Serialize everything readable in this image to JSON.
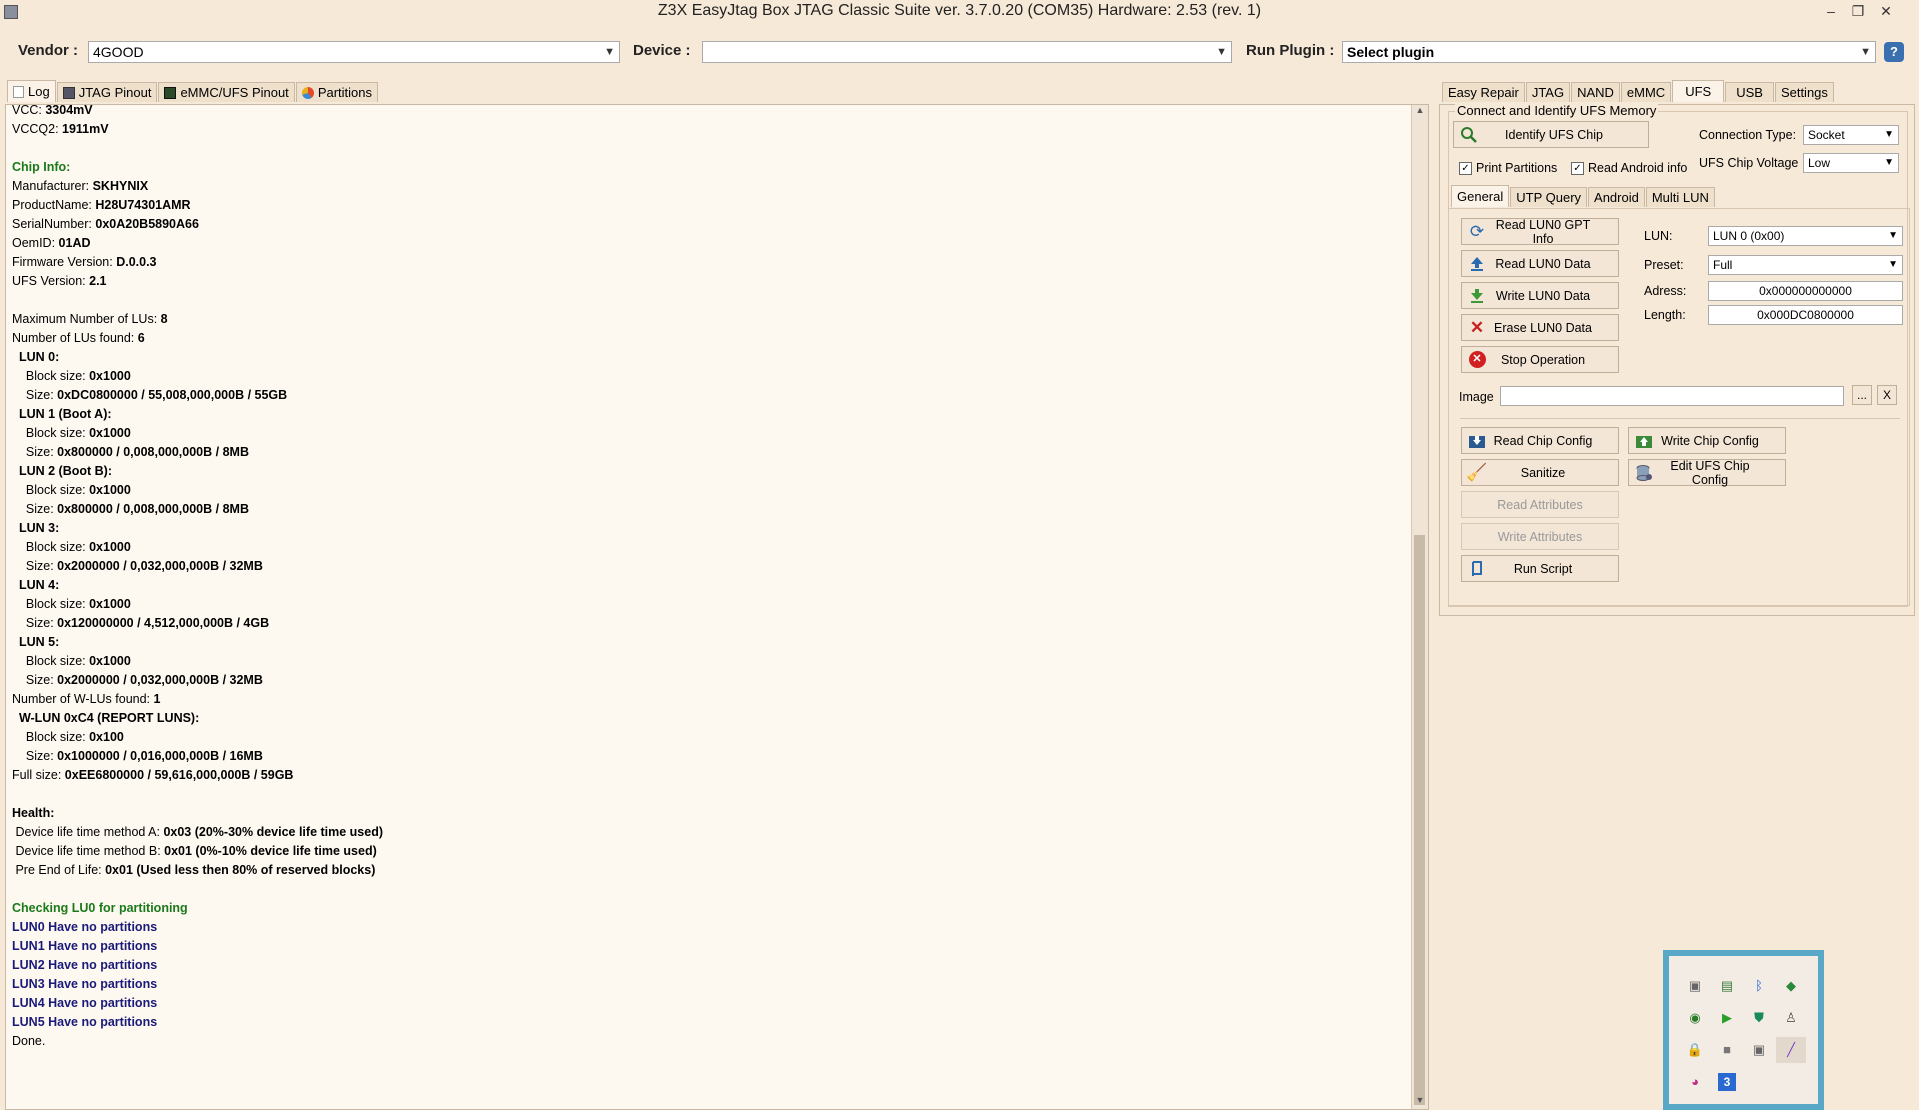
{
  "window": {
    "title": "Z3X EasyJtag Box JTAG Classic Suite ver. 3.7.0.20 (COM35) Hardware: 2.53 (rev. 1)"
  },
  "toolbar": {
    "vendor_label": "Vendor :",
    "vendor_value": "4GOOD",
    "device_label": "Device :",
    "device_value": "",
    "plugin_label": "Run Plugin :",
    "plugin_value": "Select plugin",
    "help": "?"
  },
  "left_tabs": [
    "Log",
    "JTAG Pinout",
    "eMMC/UFS Pinout",
    "Partitions"
  ],
  "right_tabs": [
    "Easy Repair",
    "JTAG",
    "NAND",
    "eMMC",
    "UFS",
    "USB",
    "Settings"
  ],
  "log": [
    {
      "k": "VCC: ",
      "v": "3304mV"
    },
    {
      "k": "VCCQ2: ",
      "v": "1911mV"
    },
    {
      "k": "",
      "v": ""
    },
    {
      "green": "Chip Info:"
    },
    {
      "k": "Manufacturer: ",
      "v": "SKHYNIX"
    },
    {
      "k": "ProductName: ",
      "v": "H28U74301AMR"
    },
    {
      "k": "SerialNumber: ",
      "v": "0x0A20B5890A66"
    },
    {
      "k": "OemID: ",
      "v": "01AD"
    },
    {
      "k": "Firmware Version: ",
      "v": "D.0.0.3"
    },
    {
      "k": "UFS Version: ",
      "v": "2.1"
    },
    {
      "k": "",
      "v": ""
    },
    {
      "k": "Maximum Number of LUs: ",
      "v": "8"
    },
    {
      "k": "Number of LUs found: ",
      "v": "6"
    },
    {
      "k": "  ",
      "v": "LUN 0:"
    },
    {
      "k": "    Block size: ",
      "v": "0x1000"
    },
    {
      "k": "    Size: ",
      "v": "0xDC0800000 / 55,008,000,000B / 55GB"
    },
    {
      "k": "  ",
      "v": "LUN 1 (Boot A):"
    },
    {
      "k": "    Block size: ",
      "v": "0x1000"
    },
    {
      "k": "    Size: ",
      "v": "0x800000 / 0,008,000,000B / 8MB"
    },
    {
      "k": "  ",
      "v": "LUN 2 (Boot B):"
    },
    {
      "k": "    Block size: ",
      "v": "0x1000"
    },
    {
      "k": "    Size: ",
      "v": "0x800000 / 0,008,000,000B / 8MB"
    },
    {
      "k": "  ",
      "v": "LUN 3:"
    },
    {
      "k": "    Block size: ",
      "v": "0x1000"
    },
    {
      "k": "    Size: ",
      "v": "0x2000000 / 0,032,000,000B / 32MB"
    },
    {
      "k": "  ",
      "v": "LUN 4:"
    },
    {
      "k": "    Block size: ",
      "v": "0x1000"
    },
    {
      "k": "    Size: ",
      "v": "0x120000000 / 4,512,000,000B / 4GB"
    },
    {
      "k": "  ",
      "v": "LUN 5:"
    },
    {
      "k": "    Block size: ",
      "v": "0x1000"
    },
    {
      "k": "    Size: ",
      "v": "0x2000000 / 0,032,000,000B / 32MB"
    },
    {
      "k": "Number of W-LUs found: ",
      "v": "1"
    },
    {
      "k": "  ",
      "v": "W-LUN 0xC4 (REPORT LUNS):"
    },
    {
      "k": "    Block size: ",
      "v": "0x100"
    },
    {
      "k": "    Size: ",
      "v": "0x1000000 / 0,016,000,000B / 16MB"
    },
    {
      "k": "Full size: ",
      "v": "0xEE6800000 / 59,616,000,000B / 59GB"
    },
    {
      "k": "",
      "v": ""
    },
    {
      "k": "",
      "v": "Health:"
    },
    {
      "k": " Device life time method A: ",
      "v": "0x03 (20%-30% device life time used)"
    },
    {
      "k": " Device life time method B: ",
      "v": "0x01 (0%-10% device life time used)"
    },
    {
      "k": " Pre End of Life: ",
      "v": "0x01 (Used less then 80% of reserved blocks)"
    },
    {
      "k": "",
      "v": ""
    },
    {
      "green": "Checking LU0 for partitioning"
    },
    {
      "navy": "LUN0 Have no partitions"
    },
    {
      "navy": "LUN1 Have no partitions"
    },
    {
      "navy": "LUN2 Have no partitions"
    },
    {
      "navy": "LUN3 Have no partitions"
    },
    {
      "navy": "LUN4 Have no partitions"
    },
    {
      "navy": "LUN5 Have no partitions"
    },
    {
      "k": "Done.",
      "v": ""
    }
  ],
  "ufs": {
    "group_title": "Connect and Identify UFS Memory",
    "identify_button": "Identify UFS Chip",
    "connection_type_label": "Connection Type:",
    "connection_type_value": "Socket",
    "print_partitions": "Print Partitions",
    "read_android_info": "Read Android info",
    "chip_voltage_label": "UFS Chip Voltage :",
    "chip_voltage_value": "Low",
    "subtabs": [
      "General",
      "UTP Query",
      "Android",
      "Multi LUN"
    ],
    "buttons": {
      "read_gpt": "Read LUN0 GPT Info",
      "read_data": "Read LUN0 Data",
      "write_data": "Write LUN0 Data",
      "erase_data": "Erase LUN0 Data",
      "stop": "Stop Operation",
      "read_config": "Read Chip Config",
      "write_config": "Write Chip Config",
      "sanitize": "Sanitize",
      "edit_config": "Edit UFS Chip Config",
      "read_attrs": "Read Attributes",
      "write_attrs": "Write Attributes",
      "run_script": "Run Script",
      "browse": "...",
      "clear": "X"
    },
    "lun_label": "LUN:",
    "lun_value": "LUN 0 (0x00)",
    "preset_label": "Preset:",
    "preset_value": "Full",
    "address_label": "Adress:",
    "address_value": "0x000000000000",
    "length_label": "Length:",
    "length_value": "0x000DC0800000",
    "image_label": "Image",
    "image_value": ""
  },
  "colors": {
    "background": "#f7e9d8",
    "log_green": "#1a7a1a",
    "log_navy": "#1a1a7a",
    "tray_border": "#5aa8c8"
  }
}
